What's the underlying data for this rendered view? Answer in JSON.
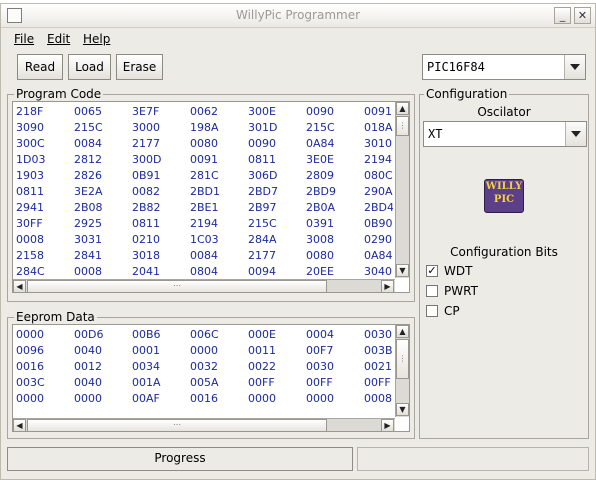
{
  "window": {
    "title": "WillyPic Programmer"
  },
  "title_buttons": [
    "_",
    "□",
    "✕"
  ],
  "menu": [
    {
      "label": "File"
    },
    {
      "label": "Edit"
    },
    {
      "label": "Help"
    }
  ],
  "toolbar": {
    "read": "Read",
    "load": "Load",
    "erase": "Erase"
  },
  "device": {
    "selected": "PIC16F84"
  },
  "program_code": {
    "label": "Program Code",
    "rows": [
      [
        "218F",
        "0065",
        "3E7F",
        "0062",
        "300E",
        "0090",
        "0091"
      ],
      [
        "3090",
        "215C",
        "3000",
        "198A",
        "301D",
        "215C",
        "018A"
      ],
      [
        "300C",
        "0084",
        "2177",
        "0080",
        "0090",
        "0A84",
        "3010"
      ],
      [
        "1D03",
        "2812",
        "300D",
        "0091",
        "0811",
        "3E0E",
        "2194"
      ],
      [
        "1903",
        "2826",
        "0B91",
        "281C",
        "306D",
        "2809",
        "080C"
      ],
      [
        "0811",
        "3E2A",
        "0082",
        "2BD1",
        "2BD7",
        "2BD9",
        "290A"
      ],
      [
        "2941",
        "2B08",
        "2B82",
        "2BE1",
        "2B97",
        "2B0A",
        "2BD4"
      ],
      [
        "30FF",
        "2925",
        "0811",
        "2194",
        "215C",
        "0391",
        "0B90"
      ],
      [
        "0008",
        "3031",
        "0210",
        "1C03",
        "284A",
        "3008",
        "0290"
      ],
      [
        "2158",
        "2841",
        "3018",
        "0084",
        "2177",
        "0080",
        "0A84"
      ],
      [
        "284C",
        "0008",
        "2041",
        "0804",
        "0094",
        "20EE",
        "3040"
      ]
    ]
  },
  "eeprom_data": {
    "label": "Eeprom Data",
    "rows": [
      [
        "0000",
        "00D6",
        "00B6",
        "006C",
        "000E",
        "0004",
        "0030"
      ],
      [
        "0096",
        "0040",
        "0001",
        "0000",
        "0011",
        "00F7",
        "003B"
      ],
      [
        "0016",
        "0012",
        "0034",
        "0032",
        "0022",
        "0030",
        "0021"
      ],
      [
        "003C",
        "0040",
        "001A",
        "005A",
        "00FF",
        "00FF",
        "00FF"
      ],
      [
        "0000",
        "0000",
        "00AF",
        "0016",
        "0000",
        "0000",
        "0008"
      ]
    ]
  },
  "configuration": {
    "label": "Configuration",
    "oscillator_label": "Oscilator",
    "oscillator_value": "XT",
    "logo_text": [
      "WILLY",
      "PIC"
    ],
    "bits_label": "Configuration Bits",
    "bits": [
      {
        "label": "WDT",
        "checked": true
      },
      {
        "label": "PWRT",
        "checked": false
      },
      {
        "label": "CP",
        "checked": false
      }
    ]
  },
  "status": {
    "progress_label": "Progress"
  },
  "icons": {
    "scroll_up": "▲",
    "scroll_down": "▼",
    "scroll_left": "◀",
    "scroll_right": "▶",
    "grip_v": "⋮",
    "grip_h": "⋯",
    "check": "✓"
  }
}
